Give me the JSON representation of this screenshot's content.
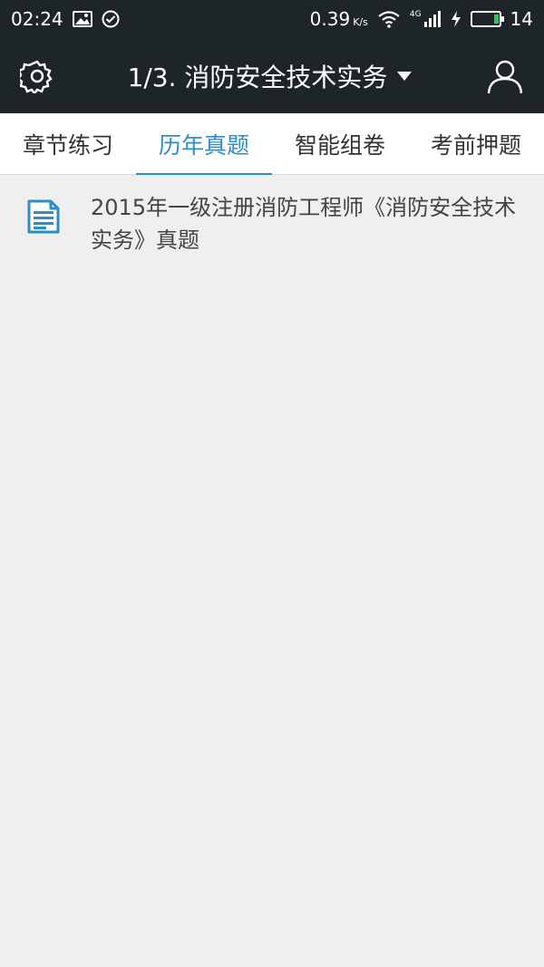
{
  "status_bar": {
    "time": "02:24",
    "speed_value": "0.39",
    "speed_unit": "K/s",
    "signal_label": "4G",
    "battery_level": "14"
  },
  "header": {
    "title": "1/3. 消防安全技术实务",
    "icons": [
      "settings-gear-icon",
      "dropdown-triangle-icon",
      "user-profile-icon"
    ]
  },
  "tabs": [
    {
      "label": "章节练习",
      "active": false
    },
    {
      "label": "历年真题",
      "active": true
    },
    {
      "label": "智能组卷",
      "active": false
    },
    {
      "label": "考前押题",
      "active": false
    }
  ],
  "items": [
    {
      "title": "2015年一级注册消防工程师《消防安全技术实务》真题",
      "icon": "document-icon"
    }
  ],
  "colors": {
    "header_bg": "#1e2528",
    "accent": "#2b8ec8",
    "content_bg": "#efefef",
    "battery_green": "#32c84e"
  }
}
